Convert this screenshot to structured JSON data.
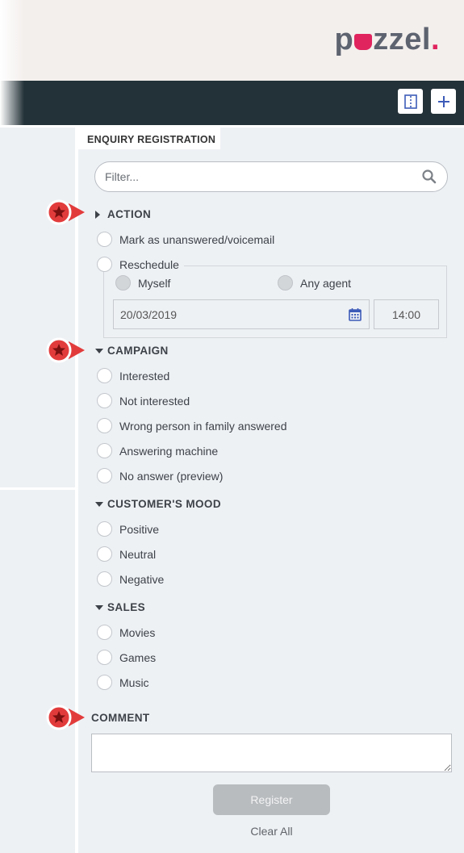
{
  "brand": {
    "logo_text_start": "p",
    "logo_text_end": "zzel",
    "logo_dot": "."
  },
  "toolbar": {
    "split_icon": "split-view-icon",
    "add_icon": "plus-icon"
  },
  "panel": {
    "tab_title": "ENQUIRY REGISTRATION"
  },
  "filter": {
    "placeholder": "Filter...",
    "icon": "search-icon"
  },
  "sections": {
    "action": {
      "title": "ACTION",
      "options": [
        "Mark as unanswered/voicemail",
        "Reschedule"
      ],
      "reschedule": {
        "options": [
          "Myself",
          "Any agent"
        ],
        "date": "20/03/2019",
        "time": "14:00"
      }
    },
    "campaign": {
      "title": "CAMPAIGN",
      "options": [
        "Interested",
        "Not interested",
        "Wrong person in family answered",
        "Answering machine",
        "No answer (preview)"
      ]
    },
    "mood": {
      "title": "CUSTOMER'S MOOD",
      "options": [
        "Positive",
        "Neutral",
        "Negative"
      ]
    },
    "sales": {
      "title": "SALES",
      "options": [
        "Movies",
        "Games",
        "Music"
      ]
    }
  },
  "comment": {
    "label": "COMMENT"
  },
  "actions": {
    "register_label": "Register",
    "clear_label": "Clear All"
  },
  "colors": {
    "accent": "#e0245e",
    "dark_bar": "#233238",
    "panel_bg": "#eef1f4",
    "marker_red": "#e23b3b",
    "icon_blue": "#3c5bb8"
  }
}
